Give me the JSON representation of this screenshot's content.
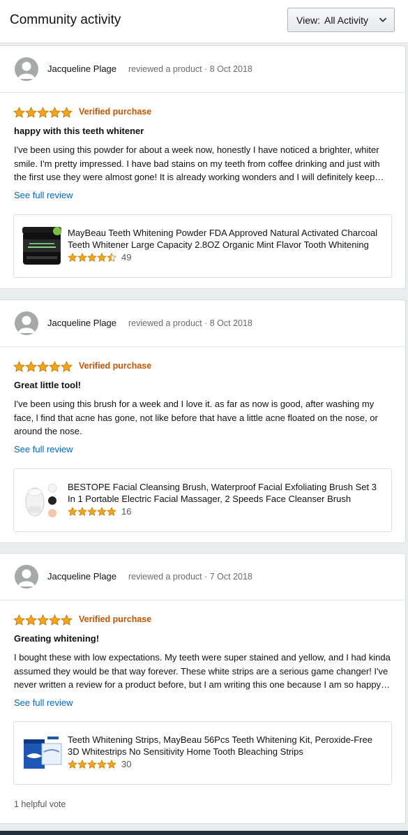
{
  "header": {
    "title": "Community activity",
    "view_label": "View:",
    "view_value": "All Activity"
  },
  "colors": {
    "star": "#f7a41d",
    "verified": "#c45500",
    "link": "#0066c0"
  },
  "reviews": [
    {
      "author": "Jacqueline Plage",
      "meta": "reviewed a product · 8 Oct 2018",
      "rating": 5,
      "verified": "Verified purchase",
      "title": "happy with this teeth whitener",
      "text": "I've been using this powder for about a week now, honestly I have noticed a brighter, whiter smile. I'm pretty impressed. I have bad stains on my teeth from coffee drinking and just with the first use they were almost gone! It is already working wonders and I will definitely keep using it.",
      "link": "See full review",
      "product": {
        "title": "MayBeau Teeth Whitening Powder FDA Approved Natural Activated Charcoal Teeth Whitener Large Capacity 2.8OZ Organic Mint Flavor Tooth Whitening",
        "rating": 4.5,
        "count": "49",
        "image": "charcoal-jar"
      }
    },
    {
      "author": "Jacqueline Plage",
      "meta": "reviewed a product · 8 Oct 2018",
      "rating": 5,
      "verified": "Verified purchase",
      "title": "Great little tool!",
      "text": "I've been using this brush for a week and I love it. as far as now is good, after washing my face, l find that acne has gone, not like before that have a little acne floated on the nose, or around the nose.",
      "link": "See full review",
      "product": {
        "title": "BESTOPE Facial Cleansing Brush, Waterproof Facial Exfoliating Brush Set 3 In 1 Portable Electric Facial Massager, 2 Speeds Face Cleanser Brush",
        "rating": 5,
        "count": "16",
        "image": "facial-brush"
      }
    },
    {
      "author": "Jacqueline Plage",
      "meta": "reviewed a product · 7 Oct 2018",
      "rating": 5,
      "verified": "Verified purchase",
      "title": "Greating whitening!",
      "text": "I bought these with low expectations. My teeth were super stained and yellow, and I had kinda assumed they would be that way forever. These white strips are a serious game changer! I've never written a review for a product before, but I am writing this one because I am so happy with the results.",
      "link": "See full review",
      "product": {
        "title": "Teeth Whitening Strips, MayBeau 56Pcs Teeth Whitening Kit, Peroxide-Free 3D Whitestrips No Sensitivity Home Tooth Bleaching Strips",
        "rating": 5,
        "count": "30",
        "image": "whitening-strips"
      },
      "helpful": "1 helpful vote"
    }
  ]
}
